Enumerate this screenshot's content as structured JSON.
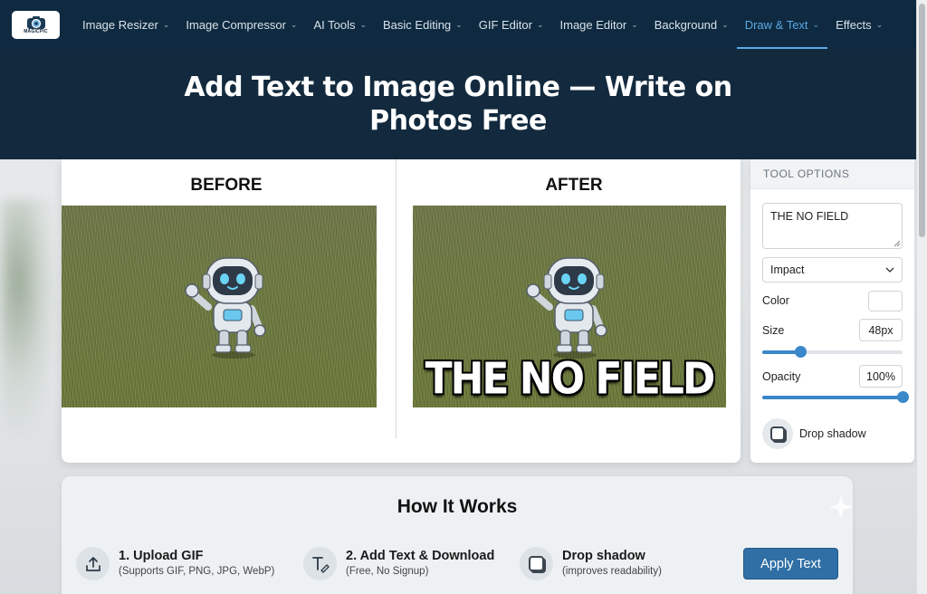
{
  "nav": {
    "logo_text": "MAGICPIC",
    "items": [
      {
        "label": "Image Resizer",
        "active": false
      },
      {
        "label": "Image Compressor",
        "active": false
      },
      {
        "label": "AI Tools",
        "active": false
      },
      {
        "label": "Basic Editing",
        "active": false
      },
      {
        "label": "GIF Editor",
        "active": false
      },
      {
        "label": "Image Editor",
        "active": false
      },
      {
        "label": "Background",
        "active": false
      },
      {
        "label": "Draw & Text",
        "active": true
      },
      {
        "label": "Effects",
        "active": false
      }
    ]
  },
  "hero": {
    "title": "Add Text to Image Online — Write on Photos Free"
  },
  "compare": {
    "before_label": "BEFORE",
    "after_label": "AFTER",
    "overlay_text": "THE NO FIELD"
  },
  "tools": {
    "header": "TOOL OPTIONS",
    "text_value": "THE NO FIELD",
    "font_value": "Impact",
    "color_label": "Color",
    "color_value": "#ffffff",
    "size_label": "Size",
    "size_value": "48px",
    "size_fraction": 0.27,
    "opacity_label": "Opacity",
    "opacity_value": "100%",
    "opacity_fraction": 1.0,
    "drop_shadow_label": "Drop shadow"
  },
  "how": {
    "title": "How It Works",
    "steps": [
      {
        "title": "1. Upload GIF",
        "sub": "(Supports GIF, PNG, JPG, WebP)",
        "icon": "upload-icon"
      },
      {
        "title": "2. Add Text & Download",
        "sub": "(Free, No Signup)",
        "icon": "text-tool-icon"
      },
      {
        "title": "Drop shadow",
        "sub": "(improves readability)",
        "icon": "drop-shadow-icon"
      }
    ],
    "apply_label": "Apply Text"
  },
  "colors": {
    "nav_bg": "#0f2a40",
    "accent": "#5aa9e6",
    "button": "#2f6fa6"
  }
}
